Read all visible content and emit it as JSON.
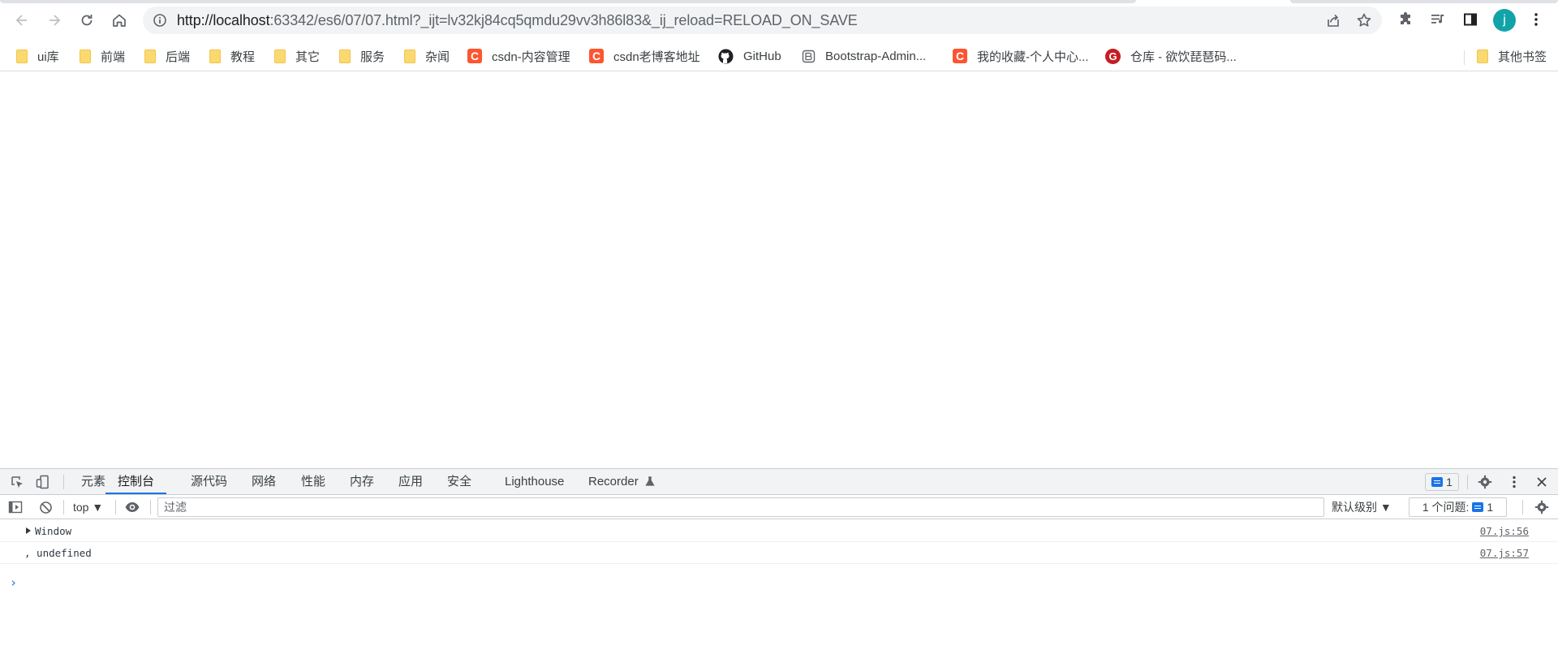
{
  "browser": {
    "url_host": "http://localhost",
    "url_rest": ":63342/es6/07/07.html?_ijt=lv32kj84cq5qmdu29vv3h86l83&_ij_reload=RELOAD_ON_SAVE",
    "profile_initial": "j"
  },
  "bookmarks": {
    "items": [
      {
        "label": "ui库",
        "icon": "folder-icon"
      },
      {
        "label": "前端",
        "icon": "folder-icon"
      },
      {
        "label": "后端",
        "icon": "folder-icon"
      },
      {
        "label": "教程",
        "icon": "folder-icon"
      },
      {
        "label": "其它",
        "icon": "folder-icon"
      },
      {
        "label": "服务",
        "icon": "folder-icon"
      },
      {
        "label": "杂闻",
        "icon": "folder-icon"
      },
      {
        "label": "csdn-内容管理",
        "icon": "csdn-icon"
      },
      {
        "label": "csdn老博客地址",
        "icon": "csdn-icon"
      },
      {
        "label": "GitHub",
        "icon": "github-icon"
      },
      {
        "label": "Bootstrap-Admin...",
        "icon": "bootstrap-admin-icon"
      },
      {
        "label": "我的收藏-个人中心...",
        "icon": "csdn-icon"
      },
      {
        "label": "仓库 - 欲饮琵琶码...",
        "icon": "gitee-icon"
      }
    ],
    "other": "其他书签",
    "csdn_glyph": "C",
    "gitee_glyph": "G"
  },
  "devtools": {
    "tabs": [
      "元素",
      "控制台",
      "源代码",
      "网络",
      "性能",
      "内存",
      "应用",
      "安全",
      "Lighthouse",
      "Recorder"
    ],
    "active_tab": "控制台",
    "issues_badge": "1",
    "context": "top ▼",
    "filter_placeholder": "过滤",
    "levels": "默认级别 ▼",
    "issues_label": "1 个问题:",
    "issues_count": "1",
    "messages": [
      {
        "text": "Window",
        "source": "07.js:56",
        "expandable": true
      },
      {
        "text": ", undefined",
        "source": "07.js:57",
        "expandable": false
      }
    ],
    "prompt": "›"
  },
  "colors": {
    "accent": "#1a73e8",
    "avatar": "#12a3a8",
    "csdn": "#fc5531",
    "gitee": "#c71d23",
    "folder": "#fbd971"
  }
}
